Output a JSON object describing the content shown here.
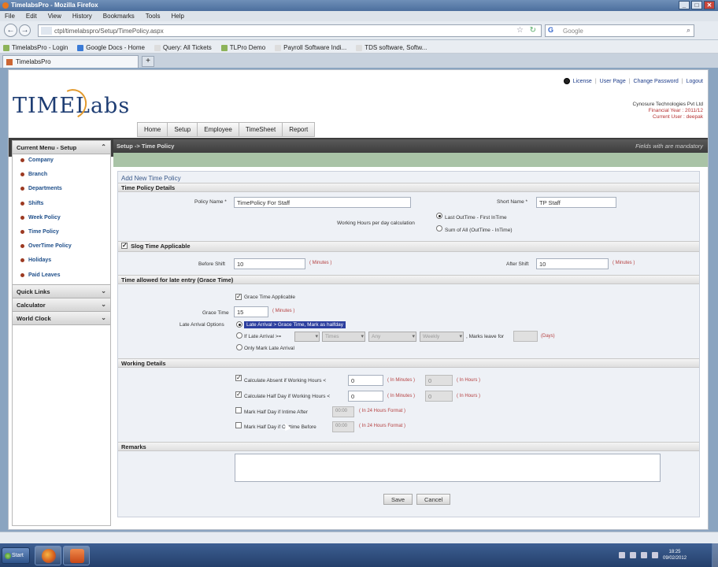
{
  "window": {
    "title": "TimelabsPro - Mozilla Firefox",
    "buttons": [
      "_",
      "□",
      "✕"
    ]
  },
  "browser_menu": [
    "File",
    "Edit",
    "View",
    "History",
    "Bookmarks",
    "Tools",
    "Help"
  ],
  "nav": {
    "back": "←",
    "forward": "→",
    "url": "ctpl/timelabspro/Setup/TimePolicy.aspx",
    "search_placeholder": "Google"
  },
  "bookmarks": [
    "TimelabsPro - Login",
    "Google Docs - Home",
    "Query: All Tickets",
    "TLPro Demo",
    "Payroll Software Indi...",
    "TDS software, Softw..."
  ],
  "tab": {
    "label": "TimelabsPro",
    "new_tab": "+"
  },
  "app": {
    "logo": "TIMELabs",
    "top_links": [
      "License",
      "User Page",
      "Change Password",
      "Logout"
    ],
    "company": "Cynosure Technologies Pvt Ltd",
    "financial_year": "Financial Year : 2011/12",
    "current_user": "Current User : deepak",
    "main_menu": [
      "Home",
      "Setup",
      "Employee",
      "TimeSheet",
      "Report"
    ],
    "breadcrumb": "Setup -> Time Policy",
    "required_note": "Fields with  are mandatory",
    "sidebar": {
      "current_menu": "Current Menu - Setup",
      "items": [
        "Company",
        "Branch",
        "Departments",
        "Shifts",
        "Week Policy",
        "Time Policy",
        "OverTime Policy",
        "Holidays",
        "Paid Leaves"
      ],
      "quick_links": "Quick Links",
      "calculator": "Calculator",
      "world_clock": "World Clock",
      "chevron": "⌄"
    }
  },
  "form": {
    "title": "Add New Time Policy",
    "sections": {
      "details": "Time Policy Details",
      "slog": "Slog Time Applicable",
      "grace": "Time allowed for late entry (Grace Time)",
      "working": "Working Details",
      "remarks": "Remarks"
    },
    "policy_name_label": "Policy Name *",
    "policy_name_value": "TimePolicy For Staff",
    "short_name_label": "Short Name *",
    "short_name_value": "TP Staff",
    "working_hours_label": "Working Hours per day calculation",
    "calc_option_1": "Last OutTime - First InTime",
    "calc_option_2": "Sum of All (OutTime - InTime)",
    "before_shift_label": "Before Shift",
    "before_shift_value": "10",
    "after_shift_label": "After Shift",
    "after_shift_value": "10",
    "minutes_hint": "( Minutes )",
    "grace_applicable": "Grace Time Applicable",
    "grace_time_label": "Grace Time",
    "grace_time_value": "15",
    "late_arrival_label": "Late Arrival Options",
    "late_opt_1": "Late Arrival > Grace Time, Mark as halfday",
    "late_opt_2": "If Late Arrival >=",
    "late_sel_1": "Times",
    "late_sel_2": "Any",
    "late_sel_3": "Weekly",
    "marks_leave_for": ", Marks leave for",
    "days_hint": "(Days)",
    "late_opt_3": "Only Mark Late Arrival",
    "absent_label": "Calculate Absent if Working Hours <",
    "absent_min": "0",
    "absent_hr": "0",
    "halfday_label": "Calculate Half Day if Working Hours <",
    "halfday_min": "0",
    "halfday_hr": "0",
    "in_minutes": "( In Minutes )",
    "in_hours": "( In Hours )",
    "mark_half_intime": "Mark Half Day if Intime After",
    "mark_half_outtime": "Mark Half Day if Outtime Before",
    "time_placeholder": "00:00",
    "hours_format": "( In 24 Hours Format )",
    "save": "Save",
    "cancel": "Cancel"
  },
  "taskbar": {
    "start": "Start",
    "time": "18:25",
    "date": "09/02/2012"
  },
  "check": "✓"
}
